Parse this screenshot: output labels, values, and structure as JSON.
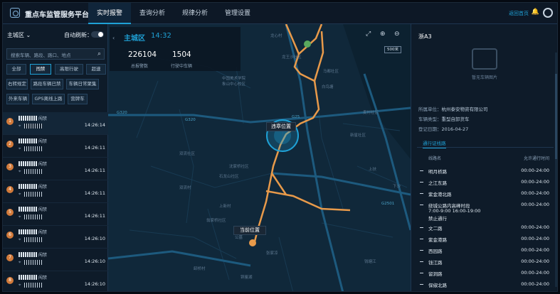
{
  "header": {
    "title": "重点车监管服务平台",
    "tabs": [
      "实时报警",
      "查询分析",
      "规律分析",
      "管理设置"
    ],
    "active_tab": 0,
    "home_label": "返回首页"
  },
  "left": {
    "zone_select": "主城区",
    "auto_refresh_label": "自动刷新：",
    "search_placeholder": "搜索车辆、路段、路口、地点",
    "filters": [
      "全部",
      "闯禁",
      "高限行驶",
      "超速",
      "右转规定",
      "路段车辆已禁",
      "车辆日常聚集",
      "外来车辆",
      "GPS离线上路",
      "营牌车"
    ],
    "active_filter": 1,
    "alarms": [
      {
        "num": "1",
        "status": "闯禁",
        "time": "14:26:14"
      },
      {
        "num": "2",
        "status": "闯禁",
        "time": "14:26:11"
      },
      {
        "num": "3",
        "status": "闯禁",
        "time": "14:26:11"
      },
      {
        "num": "4",
        "status": "闯禁",
        "time": "14:26:11"
      },
      {
        "num": "5",
        "status": "闯禁",
        "time": "14:26:11"
      },
      {
        "num": "6",
        "status": "闯禁",
        "time": "14:26:10"
      },
      {
        "num": "7",
        "status": "闯禁",
        "time": "14:26:10"
      },
      {
        "num": "8",
        "status": "闯禁",
        "time": "14:26:10"
      }
    ]
  },
  "map": {
    "zone": "主城区",
    "time": "14:32",
    "stat_total_value": "226104",
    "stat_total_label": "总报警数",
    "stat_moving_value": "1504",
    "stat_moving_label": "行驶中车辆",
    "scale": "500米",
    "violation_label": "违章位置",
    "current_label": "当前位置",
    "place_labels": [
      "龙心村",
      "龙王沙社区",
      "马都社区",
      "白鸟塘",
      "麦村社区",
      "新星社区",
      "中国美术学院",
      "象山中心校区",
      "沈家桥社区",
      "双流社区",
      "双流村",
      "石龙山社区",
      "上新村",
      "翁家桥社区",
      "公墓",
      "张家凉",
      "卸桥村",
      "铜鉴湖",
      "上扶",
      "下沙",
      "钱塘江"
    ],
    "highway_labels": [
      "G320",
      "G25",
      "G2501",
      "G320"
    ]
  },
  "right": {
    "plate": "浙A3",
    "photo_label": "暂无车辆图片",
    "owner_label": "所属单位：",
    "owner_value": "杭州泰安物资有限公司",
    "type_label": "车辆类型：",
    "type_value": "重型自卸货车",
    "date_label": "登记日期：",
    "date_value": "2016-04-27",
    "tab": "通行证线路",
    "col_route": "线路名",
    "col_time": "允许通行时间",
    "routes": [
      {
        "name": "明月桥路",
        "time": "00:00-24:00"
      },
      {
        "name": "之江东路",
        "time": "00:00-24:00"
      },
      {
        "name": "紫金港北路",
        "time": "00:00-24:00"
      },
      {
        "name": "绕城公路内高峰时段",
        "time": "00:00-24:00"
      },
      {
        "name": "7:00-9:00 16:00-19:00",
        "time": ""
      },
      {
        "name": "禁止通行",
        "time": ""
      },
      {
        "name": "文二路",
        "time": "00:00-24:00"
      },
      {
        "name": "紫金港路",
        "time": "00:00-24:00"
      },
      {
        "name": "西园路",
        "time": "00:00-24:00"
      },
      {
        "name": "钱江路",
        "time": "00:00-24:00"
      },
      {
        "name": "留洞路",
        "time": "00:00-24:00"
      },
      {
        "name": "保俶北路",
        "time": "00:00-24:00"
      }
    ]
  }
}
